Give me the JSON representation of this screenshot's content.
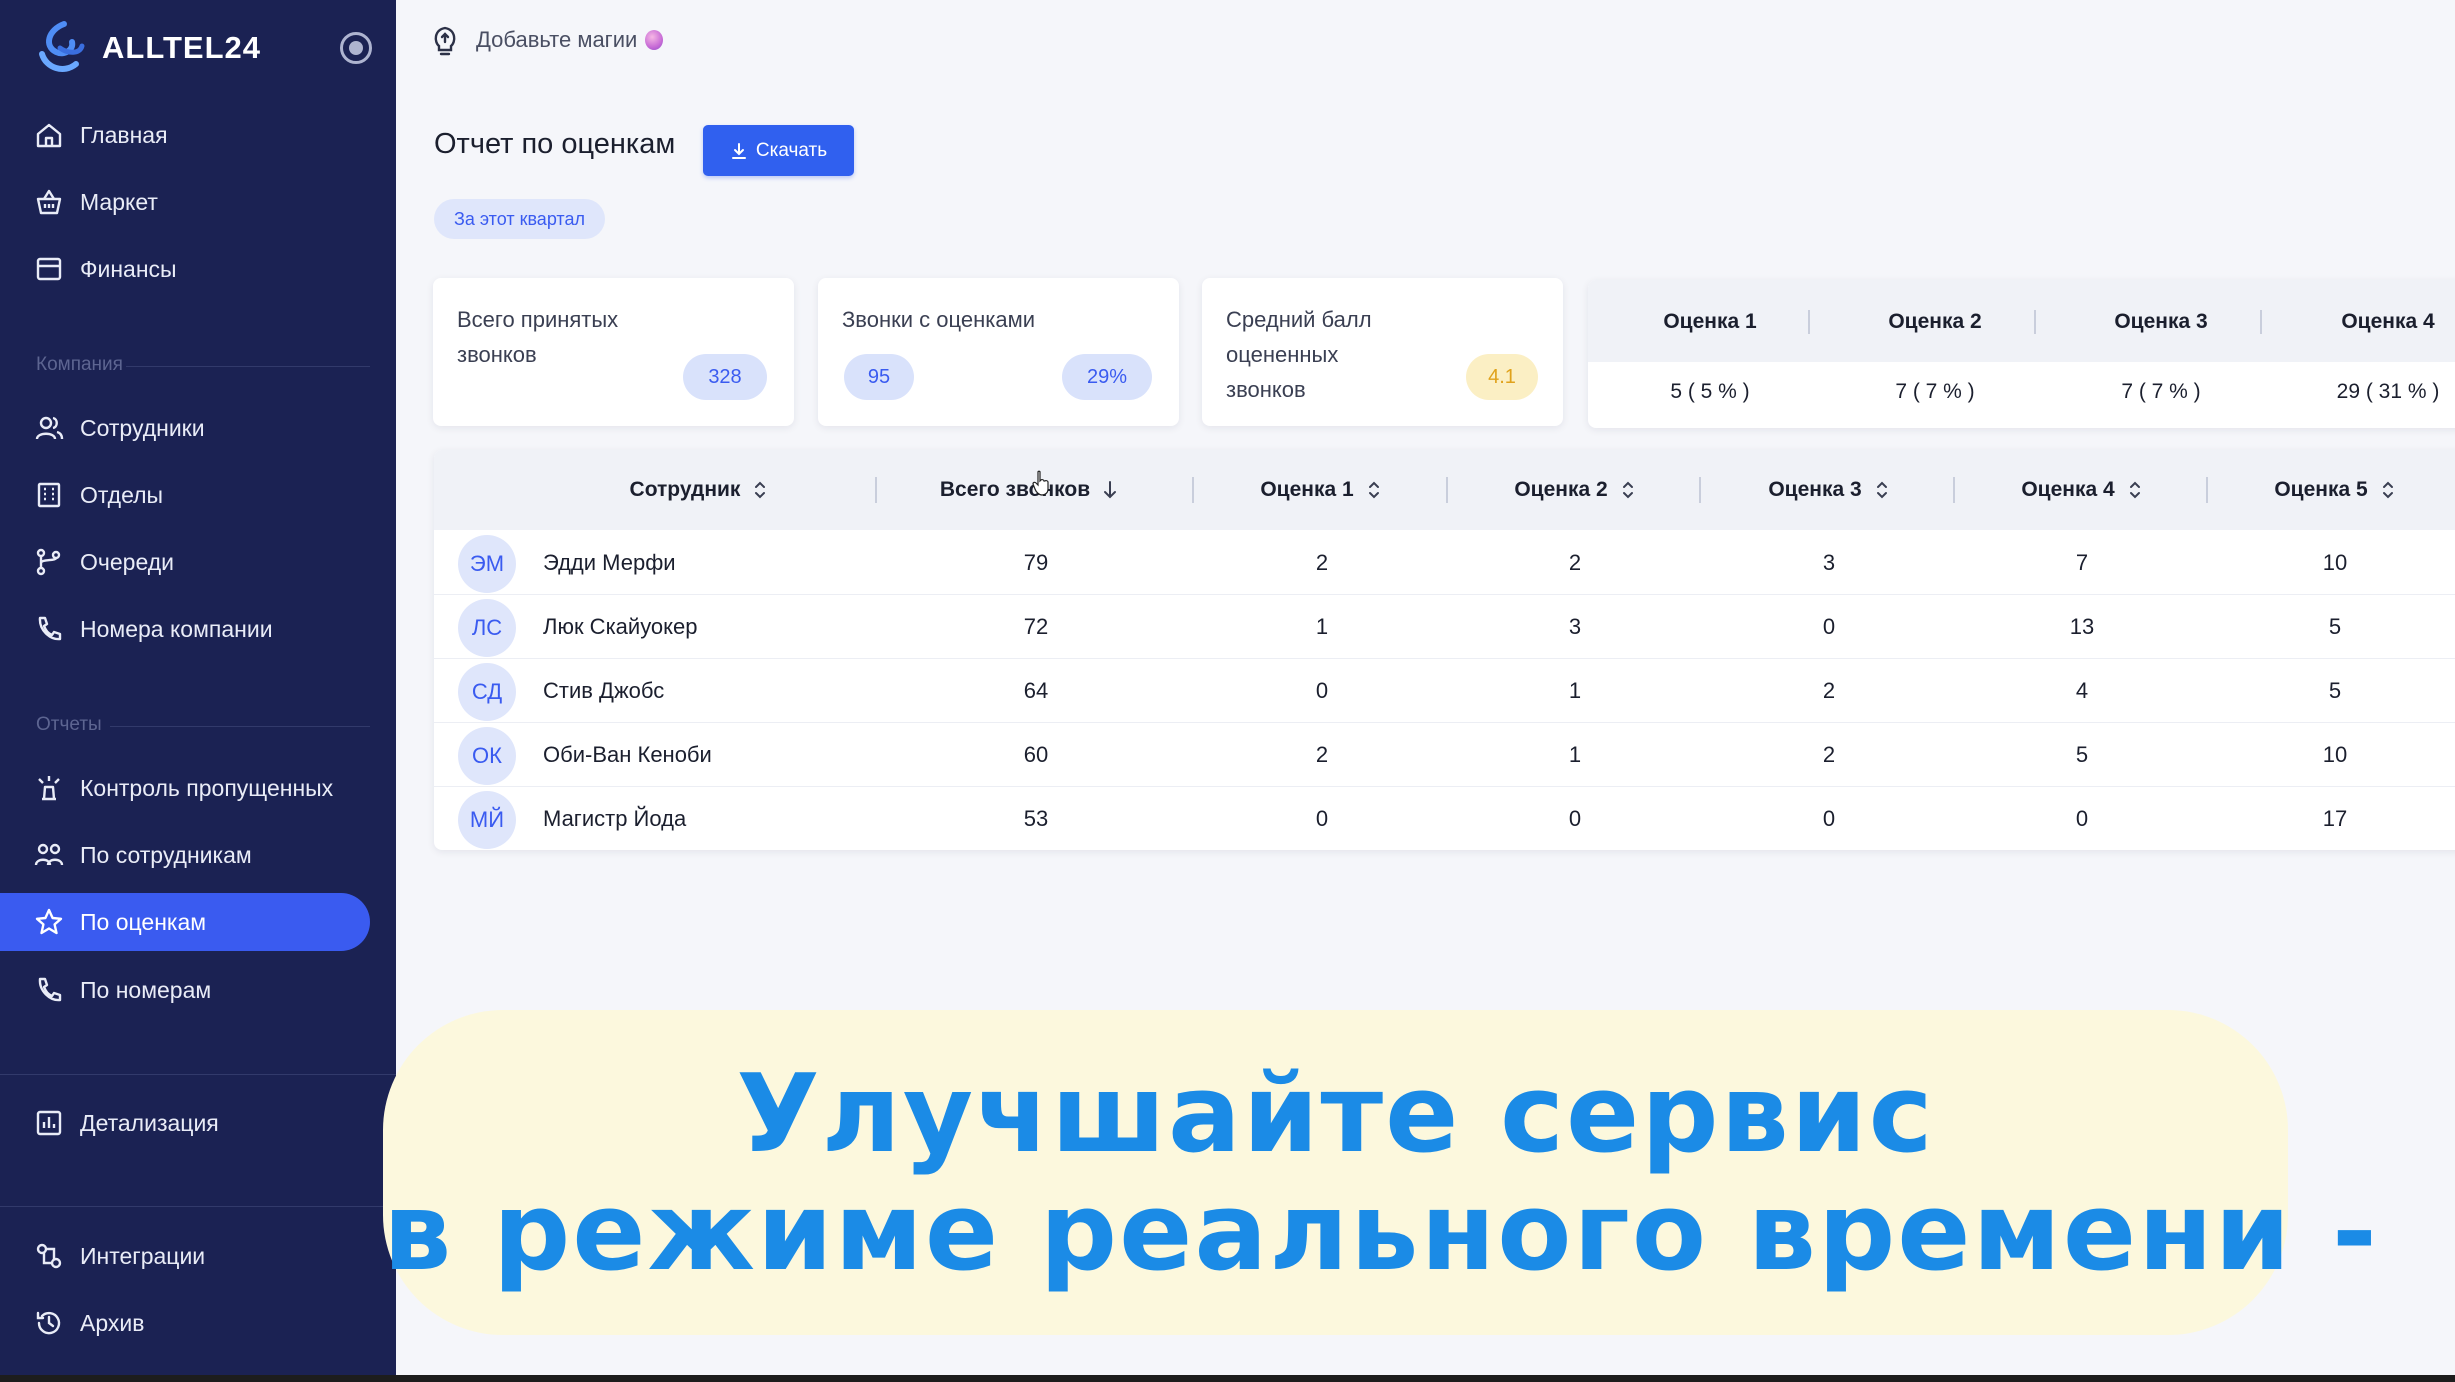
{
  "brand": {
    "name": "ALLTEL24"
  },
  "sidebar": {
    "items": [
      {
        "label": "Главная"
      },
      {
        "label": "Маркет"
      },
      {
        "label": "Финансы"
      }
    ],
    "section_company": "Компания",
    "company_items": [
      {
        "label": "Сотрудники"
      },
      {
        "label": "Отделы"
      },
      {
        "label": "Очереди"
      },
      {
        "label": "Номера компании"
      }
    ],
    "section_reports": "Отчеты",
    "report_items": [
      {
        "label": "Контроль пропущенных"
      },
      {
        "label": "По сотрудникам"
      },
      {
        "label": "По оценкам"
      },
      {
        "label": "По номерам"
      }
    ],
    "details": {
      "label": "Детализация"
    },
    "bottom_items": [
      {
        "label": "Интеграции"
      },
      {
        "label": "Архив"
      }
    ]
  },
  "topbar": {
    "magic_label": "Добавьте магии"
  },
  "page": {
    "title": "Отчет по оценкам",
    "download_label": "Скачать",
    "period_chip": "За этот квартал"
  },
  "stats": {
    "total_calls": {
      "title_line1": "Всего принятых",
      "title_line2": "звонков",
      "value": "328"
    },
    "rated_calls": {
      "title": "Звонки с оценками",
      "count": "95",
      "percent": "29%"
    },
    "avg_score": {
      "title_line1": "Средний балл",
      "title_line2": "оцененных",
      "title_line3": "звонков",
      "value": "4.1"
    }
  },
  "rating_summary": {
    "headers": [
      "Оценка 1",
      "Оценка 2",
      "Оценка 3",
      "Оценка 4"
    ],
    "values": [
      "5 ( 5 % )",
      "7 ( 7 % )",
      "7 ( 7 % )",
      "29 ( 31 % )"
    ]
  },
  "table": {
    "headers": [
      "Сотрудник",
      "Всего звонков",
      "Оценка 1",
      "Оценка 2",
      "Оценка 3",
      "Оценка 4",
      "Оценка 5"
    ],
    "rows": [
      {
        "initials": "ЭМ",
        "name": "Эдди Мерфи",
        "total": "79",
        "r1": "2",
        "r2": "2",
        "r3": "3",
        "r4": "7",
        "r5": "10"
      },
      {
        "initials": "ЛС",
        "name": "Люк Скайуокер",
        "total": "72",
        "r1": "1",
        "r2": "3",
        "r3": "0",
        "r4": "13",
        "r5": "5"
      },
      {
        "initials": "СД",
        "name": "Стив Джобс",
        "total": "64",
        "r1": "0",
        "r2": "1",
        "r3": "2",
        "r4": "4",
        "r5": "5"
      },
      {
        "initials": "ОК",
        "name": "Оби-Ван Кеноби",
        "total": "60",
        "r1": "2",
        "r2": "1",
        "r3": "2",
        "r4": "5",
        "r5": "10"
      },
      {
        "initials": "МЙ",
        "name": "Магистр Йода",
        "total": "53",
        "r1": "0",
        "r2": "0",
        "r3": "0",
        "r4": "0",
        "r5": "17"
      }
    ]
  },
  "caption": {
    "line1": "Улучшайте сервис",
    "line2": "в режиме реального времени -"
  },
  "colors": {
    "sidebar_bg": "#1b2253",
    "accent": "#3a5bf0",
    "caption_text": "#1b8be6",
    "caption_bg": "#fcf8dd"
  },
  "icons": [
    "home-icon",
    "market-icon",
    "finance-icon",
    "users-icon",
    "departments-icon",
    "queues-icon",
    "phone-icon",
    "missed-icon",
    "employees-report-icon",
    "star-icon",
    "details-icon",
    "integrations-icon",
    "archive-icon",
    "lightbulb-icon",
    "download-icon",
    "sort-icon",
    "sort-down-icon"
  ]
}
